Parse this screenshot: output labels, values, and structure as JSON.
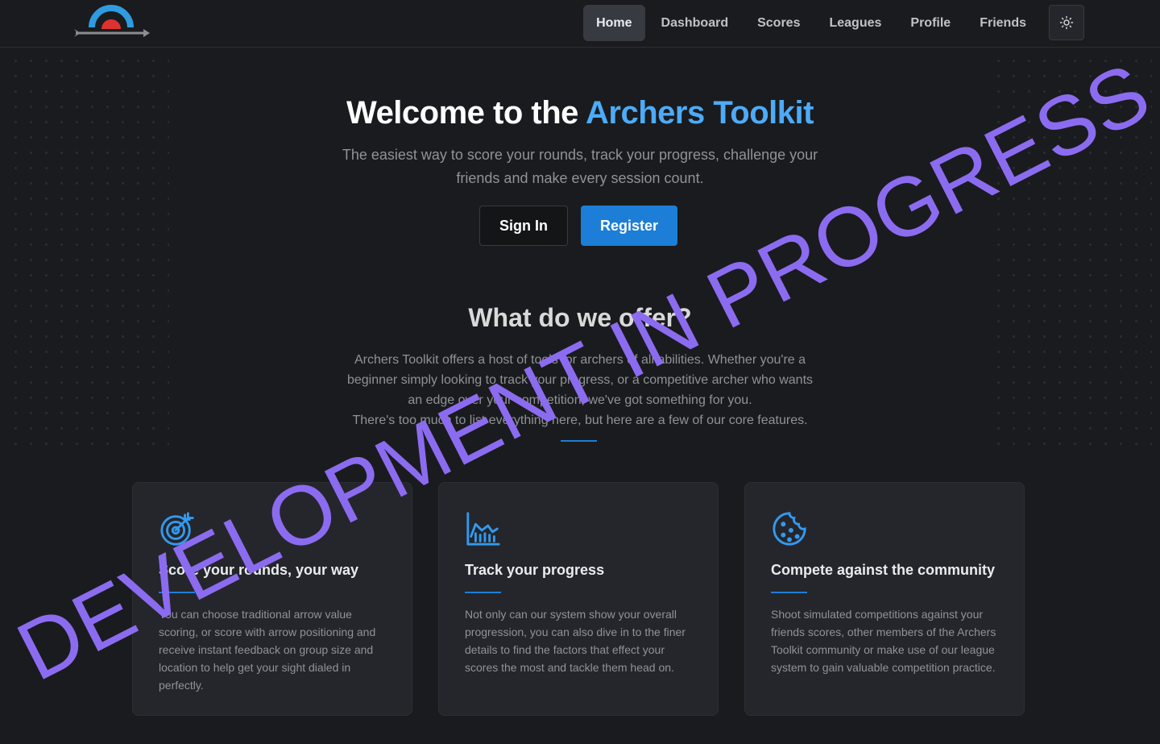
{
  "nav": {
    "links": [
      "Home",
      "Dashboard",
      "Scores",
      "Leagues",
      "Profile",
      "Friends"
    ],
    "active": "Home",
    "theme_toggle_icon": "sun-icon"
  },
  "hero": {
    "title_prefix": "Welcome to the ",
    "title_accent": "Archers Toolkit",
    "subtitle": "The easiest way to score your rounds, track your progress, challenge your friends and make every session count.",
    "signin_label": "Sign In",
    "register_label": "Register"
  },
  "offer": {
    "title": "What do we offer?",
    "text_1": "Archers Toolkit offers a host of tools for archers of all abilities. Whether you're a beginner simply looking to track your progress, or a competitive archer who wants an edge over your competition, we've got something for you.",
    "text_2": "There's too much to list everything here, but here are a few of our core features."
  },
  "cards": [
    {
      "icon": "target-icon",
      "title": "Score your rounds, your way",
      "text": "You can choose traditional arrow value scoring, or score with arrow positioning and receive instant feedback on group size and location to help get your sight dialed in perfectly."
    },
    {
      "icon": "chart-area-icon",
      "title": "Track your progress",
      "text": "Not only can our system show your overall progression, you can also dive in to the finer details to find the factors that effect your scores the most and tackle them head on."
    },
    {
      "icon": "cookie-icon",
      "title": "Compete against the community",
      "text": "Shoot simulated competitions against your friends scores, other members of the Archers Toolkit community or make use of our league system to gain valuable competition practice."
    }
  ],
  "watermark": "DEVELOPMENT IN PROGRESS",
  "colors": {
    "accent": "#1c7ed6",
    "accent_light": "#4dabf7",
    "background": "#1a1b1e",
    "card": "#25262b",
    "watermark": "#8b6cf0"
  }
}
